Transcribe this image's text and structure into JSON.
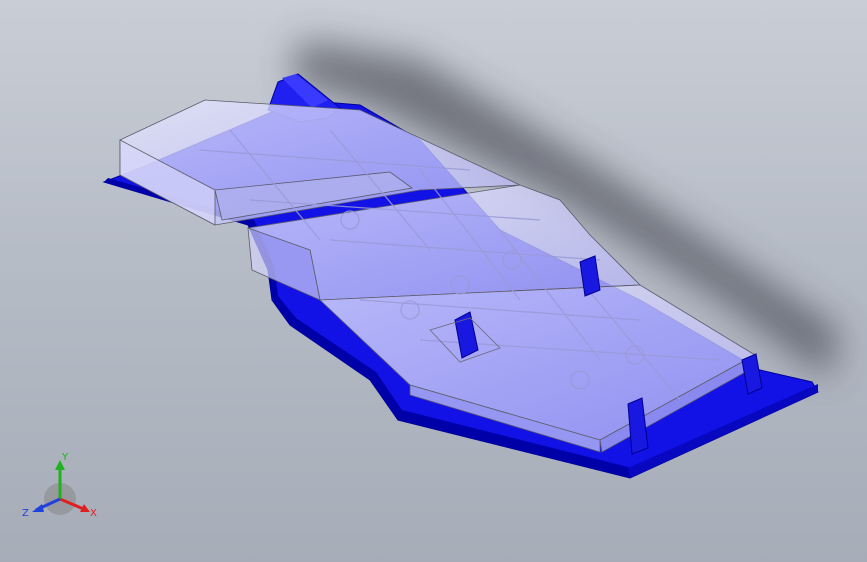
{
  "viewport": {
    "background_top": "#c9ced6",
    "background_bottom": "#a7adb8"
  },
  "part": {
    "body_color": "#1010e8",
    "body_dark": "#0000b0",
    "transparent_cover_color": "#c8c8f8",
    "edge_color": "#505060"
  },
  "triad": {
    "x_label": "X",
    "y_label": "Y",
    "z_label": "Z",
    "x_color": "#e02020",
    "y_color": "#20b020",
    "z_color": "#2040e0"
  }
}
